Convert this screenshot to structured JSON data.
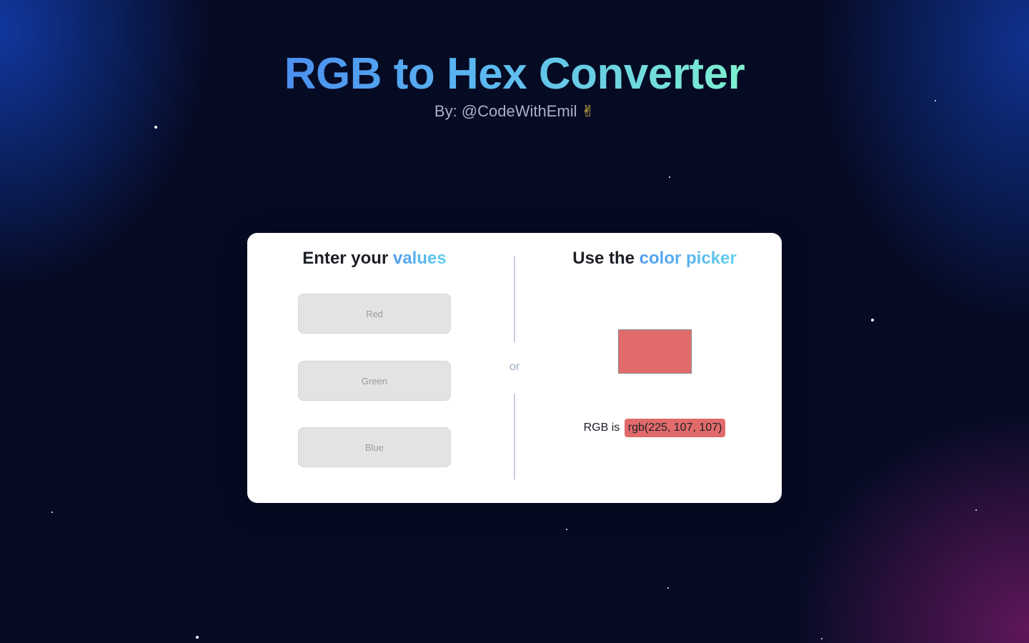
{
  "header": {
    "title": "RGB to Hex Converter",
    "byline": "By: @CodeWithEmil",
    "byline_emoji": "✌"
  },
  "left_panel": {
    "heading_prefix": "Enter your",
    "heading_highlight": "values",
    "inputs": {
      "red": {
        "placeholder": "Red",
        "value": ""
      },
      "green": {
        "placeholder": "Green",
        "value": ""
      },
      "blue": {
        "placeholder": "Blue",
        "value": ""
      }
    }
  },
  "divider": {
    "label": "or"
  },
  "right_panel": {
    "heading_prefix": "Use the",
    "heading_highlight": "color picker",
    "picker_color": "#e16b6b",
    "result_label": "RGB is",
    "result_value": "rgb(225, 107, 107)"
  },
  "colors": {
    "background": "#060b24",
    "card": "#ffffff",
    "accent_gradient_start": "#4b8ff0",
    "accent_gradient_end": "#7ef0cf",
    "swatch": "#e16b6b"
  }
}
